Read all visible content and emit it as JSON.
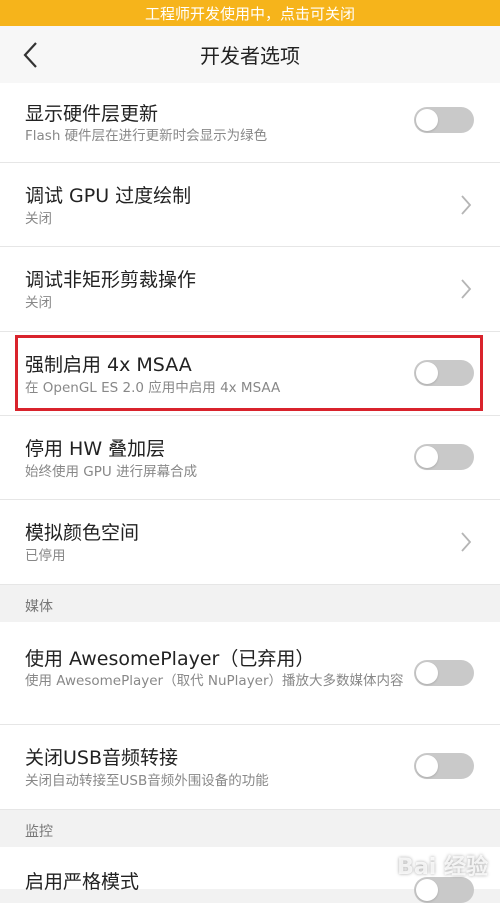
{
  "banner": {
    "text": "工程师开发使用中，点击可关闭"
  },
  "header": {
    "title": "开发者选项"
  },
  "rows": [
    {
      "title": "显示硬件层更新",
      "subtitle": "Flash 硬件层在进行更新时会显示为绿色",
      "control": "toggle",
      "on": false
    },
    {
      "title": "调试 GPU 过度绘制",
      "subtitle": "关闭",
      "control": "chevron-right-icon"
    },
    {
      "title": "调试非矩形剪裁操作",
      "subtitle": "关闭",
      "control": "chevron-right-icon"
    },
    {
      "title": "强制启用 4x MSAA",
      "subtitle": "在 OpenGL ES 2.0 应用中启用 4x MSAA",
      "control": "toggle",
      "on": false
    },
    {
      "title": "停用 HW 叠加层",
      "subtitle": "始终使用 GPU 进行屏幕合成",
      "control": "toggle",
      "on": false
    },
    {
      "title": "模拟颜色空间",
      "subtitle": "已停用",
      "control": "chevron-right-icon"
    }
  ],
  "sections": {
    "media": "媒体",
    "monitor": "监控"
  },
  "media_rows": [
    {
      "title": "使用 AwesomePlayer（已弃用）",
      "subtitle": "使用 AwesomePlayer（取代 NuPlayer）播放大多数媒体内容",
      "control": "toggle",
      "on": false
    },
    {
      "title": "关闭USB音频转接",
      "subtitle": "关闭自动转接至USB音频外围设备的功能",
      "control": "toggle",
      "on": false
    }
  ],
  "monitor_rows": [
    {
      "title": "启用严格模式",
      "control": "toggle",
      "on": false
    }
  ],
  "watermark": {
    "text": "Bai 经验"
  },
  "colors": {
    "banner": "#f6b41b",
    "highlight": "#d9232c",
    "toggle_off": "#c9c9c9"
  }
}
